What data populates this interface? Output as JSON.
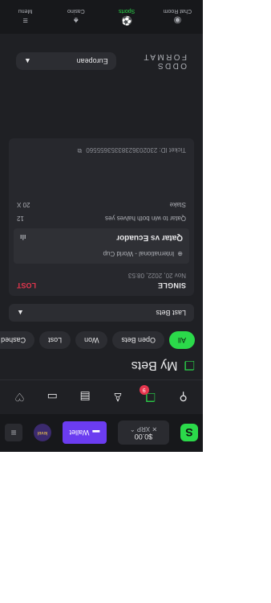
{
  "header": {
    "balance": "$0.00",
    "currency": "XRP",
    "wallet_label": "Wallet",
    "avatar_text": "level"
  },
  "quick_actions": {
    "notification_count": "9"
  },
  "page": {
    "title": "My Bets"
  },
  "filters": [
    "All",
    "Open Bets",
    "Won",
    "Lost",
    "Cashed Out"
  ],
  "dropdown": {
    "value": "Last Bets"
  },
  "bet": {
    "type": "SINGLE",
    "status": "LOST",
    "date": "Nov 20, 2022, 08:53",
    "competition": "International - World Cup",
    "match": "Qatar vs Ecuador",
    "selection": "Qatar to win both halves yes",
    "odds": "12",
    "stake_label": "Stake",
    "stake_value": "20 X",
    "ticket_id": "Ticket ID: 23020362383353655560"
  },
  "odds_format": {
    "label": "ODDS FORMAT",
    "value": "European"
  },
  "bottom_nav": [
    {
      "label": "Chat Room",
      "icon": "chat-icon"
    },
    {
      "label": "Sports",
      "icon": "soccer-icon",
      "active": true
    },
    {
      "label": "Casino",
      "icon": "casino-icon"
    },
    {
      "label": "Menu",
      "icon": "menu-icon"
    }
  ],
  "colors": {
    "accent": "#2bd94a",
    "lost": "#e6364e",
    "wallet": "#6b3cf0",
    "background": "#1f2024"
  }
}
